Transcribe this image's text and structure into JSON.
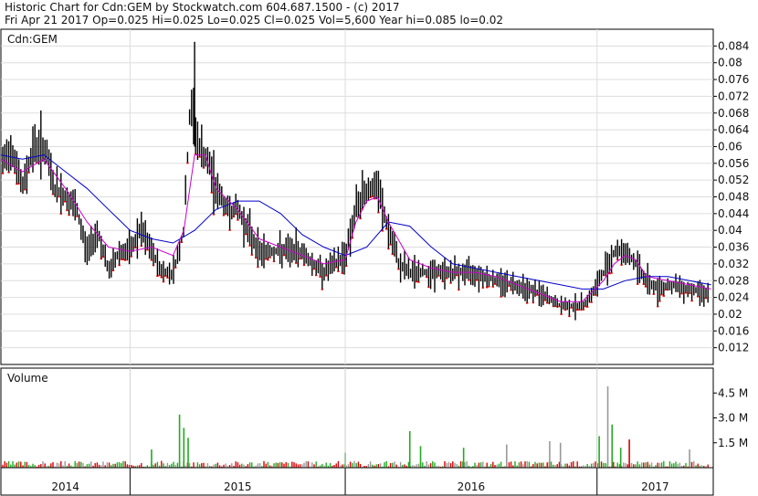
{
  "header": {
    "line1": "Historic Chart for Cdn:GEM by Stockwatch.com 604.687.1500 - (c) 2017",
    "line2": "Fri Apr 21 2017  Op=0.025  Hi=0.025  Lo=0.025  Cl=0.025  Vol=5,600  Year hi=0.085  lo=0.02"
  },
  "colors": {
    "price_bar": "#000000",
    "down_tick": "#dd0000",
    "ma_short": "#cc00cc",
    "ma_long": "#0000cc",
    "vol_up": "#22aa22",
    "vol_down": "#dd0000",
    "vol_flat": "#999999",
    "grid": "#dddddd"
  },
  "chart_data": [
    {
      "type": "bar",
      "subtype": "ohlc",
      "panel": "price",
      "label": "Cdn:GEM",
      "ylim": [
        0.008,
        0.088
      ],
      "y_ticks": [
        "0.084",
        "0.08",
        "0.076",
        "0.072",
        "0.068",
        "0.064",
        "0.06",
        "0.056",
        "0.052",
        "0.048",
        "0.044",
        "0.04",
        "0.036",
        "0.032",
        "0.028",
        "0.024",
        "0.02",
        "0.016",
        "0.012"
      ],
      "y_tick_values": [
        0.084,
        0.08,
        0.076,
        0.072,
        0.068,
        0.064,
        0.06,
        0.056,
        0.052,
        0.048,
        0.044,
        0.04,
        0.036,
        0.032,
        0.028,
        0.024,
        0.02,
        0.016,
        0.012
      ],
      "x_range": [
        2014.0,
        2017.31
      ],
      "grid": true,
      "series": [
        {
          "key": "price",
          "points": [
            [
              2014.0,
              0.055
            ],
            [
              2014.05,
              0.06
            ],
            [
              2014.1,
              0.05
            ],
            [
              2014.15,
              0.06
            ],
            [
              2014.2,
              0.06
            ],
            [
              2014.25,
              0.05
            ],
            [
              2014.3,
              0.048
            ],
            [
              2014.35,
              0.045
            ],
            [
              2014.4,
              0.035
            ],
            [
              2014.45,
              0.04
            ],
            [
              2014.5,
              0.03
            ],
            [
              2014.55,
              0.035
            ],
            [
              2014.6,
              0.035
            ],
            [
              2014.65,
              0.04
            ],
            [
              2014.7,
              0.035
            ],
            [
              2014.75,
              0.03
            ],
            [
              2014.8,
              0.03
            ],
            [
              2014.85,
              0.04
            ],
            [
              2014.88,
              0.07
            ],
            [
              2014.92,
              0.06
            ],
            [
              2014.97,
              0.055
            ],
            [
              2015.0,
              0.05
            ],
            [
              2015.05,
              0.045
            ],
            [
              2015.1,
              0.045
            ],
            [
              2015.15,
              0.04
            ],
            [
              2015.2,
              0.035
            ],
            [
              2015.3,
              0.035
            ],
            [
              2015.4,
              0.035
            ],
            [
              2015.45,
              0.032
            ],
            [
              2015.5,
              0.03
            ],
            [
              2015.55,
              0.032
            ],
            [
              2015.6,
              0.034
            ],
            [
              2015.65,
              0.045
            ],
            [
              2015.7,
              0.05
            ],
            [
              2015.75,
              0.05
            ],
            [
              2015.8,
              0.04
            ],
            [
              2015.85,
              0.032
            ],
            [
              2015.9,
              0.03
            ],
            [
              2016.0,
              0.03
            ],
            [
              2016.1,
              0.03
            ],
            [
              2016.2,
              0.03
            ],
            [
              2016.3,
              0.028
            ],
            [
              2016.4,
              0.027
            ],
            [
              2016.45,
              0.026
            ],
            [
              2016.5,
              0.025
            ],
            [
              2016.6,
              0.022
            ],
            [
              2016.7,
              0.022
            ],
            [
              2016.75,
              0.025
            ],
            [
              2016.8,
              0.03
            ],
            [
              2016.85,
              0.035
            ],
            [
              2016.9,
              0.035
            ],
            [
              2016.95,
              0.032
            ],
            [
              2017.0,
              0.028
            ],
            [
              2017.05,
              0.026
            ],
            [
              2017.1,
              0.027
            ],
            [
              2017.2,
              0.026
            ],
            [
              2017.3,
              0.025
            ]
          ]
        },
        {
          "key": "ma_short",
          "points": [
            [
              2014.0,
              0.057
            ],
            [
              2014.1,
              0.054
            ],
            [
              2014.2,
              0.057
            ],
            [
              2014.3,
              0.05
            ],
            [
              2014.4,
              0.042
            ],
            [
              2014.5,
              0.036
            ],
            [
              2014.6,
              0.035
            ],
            [
              2014.7,
              0.036
            ],
            [
              2014.8,
              0.034
            ],
            [
              2014.85,
              0.04
            ],
            [
              2014.9,
              0.058
            ],
            [
              2014.95,
              0.058
            ],
            [
              2015.0,
              0.05
            ],
            [
              2015.1,
              0.045
            ],
            [
              2015.2,
              0.038
            ],
            [
              2015.3,
              0.036
            ],
            [
              2015.4,
              0.034
            ],
            [
              2015.5,
              0.032
            ],
            [
              2015.6,
              0.033
            ],
            [
              2015.65,
              0.042
            ],
            [
              2015.7,
              0.047
            ],
            [
              2015.75,
              0.048
            ],
            [
              2015.8,
              0.042
            ],
            [
              2015.9,
              0.033
            ],
            [
              2016.0,
              0.031
            ],
            [
              2016.1,
              0.03
            ],
            [
              2016.2,
              0.03
            ],
            [
              2016.3,
              0.029
            ],
            [
              2016.4,
              0.027
            ],
            [
              2016.5,
              0.025
            ],
            [
              2016.6,
              0.023
            ],
            [
              2016.7,
              0.023
            ],
            [
              2016.8,
              0.028
            ],
            [
              2016.85,
              0.032
            ],
            [
              2016.9,
              0.034
            ],
            [
              2016.95,
              0.033
            ],
            [
              2017.0,
              0.029
            ],
            [
              2017.1,
              0.028
            ],
            [
              2017.2,
              0.027
            ],
            [
              2017.3,
              0.026
            ]
          ]
        },
        {
          "key": "ma_long",
          "points": [
            [
              2014.0,
              0.058
            ],
            [
              2014.1,
              0.057
            ],
            [
              2014.2,
              0.058
            ],
            [
              2014.3,
              0.054
            ],
            [
              2014.4,
              0.05
            ],
            [
              2014.5,
              0.045
            ],
            [
              2014.6,
              0.04
            ],
            [
              2014.7,
              0.038
            ],
            [
              2014.8,
              0.037
            ],
            [
              2014.9,
              0.04
            ],
            [
              2015.0,
              0.045
            ],
            [
              2015.1,
              0.047
            ],
            [
              2015.2,
              0.047
            ],
            [
              2015.3,
              0.044
            ],
            [
              2015.4,
              0.039
            ],
            [
              2015.5,
              0.036
            ],
            [
              2015.6,
              0.034
            ],
            [
              2015.7,
              0.036
            ],
            [
              2015.8,
              0.042
            ],
            [
              2015.9,
              0.041
            ],
            [
              2016.0,
              0.036
            ],
            [
              2016.1,
              0.032
            ],
            [
              2016.2,
              0.031
            ],
            [
              2016.3,
              0.03
            ],
            [
              2016.4,
              0.029
            ],
            [
              2016.5,
              0.028
            ],
            [
              2016.6,
              0.027
            ],
            [
              2016.7,
              0.026
            ],
            [
              2016.8,
              0.026
            ],
            [
              2016.9,
              0.028
            ],
            [
              2017.0,
              0.029
            ],
            [
              2017.1,
              0.029
            ],
            [
              2017.2,
              0.028
            ],
            [
              2017.3,
              0.027
            ]
          ]
        }
      ]
    },
    {
      "type": "bar",
      "panel": "volume",
      "label": "Volume",
      "ylim": [
        0,
        6000000
      ],
      "y_ticks": [
        "4.5 M",
        "3.0 M",
        "1.5 M"
      ],
      "y_tick_values": [
        4500000,
        3000000,
        1500000
      ],
      "x_range": [
        2014.0,
        2017.31
      ],
      "grid": false,
      "spikes": [
        {
          "x": 2014.83,
          "v": 3200000,
          "dir": "up"
        },
        {
          "x": 2014.85,
          "v": 2400000,
          "dir": "up"
        },
        {
          "x": 2014.87,
          "v": 1800000,
          "dir": "up"
        },
        {
          "x": 2014.7,
          "v": 1100000,
          "dir": "up"
        },
        {
          "x": 2015.6,
          "v": 900000,
          "dir": "up"
        },
        {
          "x": 2015.9,
          "v": 2200000,
          "dir": "up"
        },
        {
          "x": 2015.95,
          "v": 1300000,
          "dir": "up"
        },
        {
          "x": 2016.15,
          "v": 1200000,
          "dir": "up"
        },
        {
          "x": 2016.35,
          "v": 1400000,
          "dir": "flat"
        },
        {
          "x": 2016.55,
          "v": 1600000,
          "dir": "flat"
        },
        {
          "x": 2016.6,
          "v": 1500000,
          "dir": "flat"
        },
        {
          "x": 2016.78,
          "v": 1900000,
          "dir": "up"
        },
        {
          "x": 2016.82,
          "v": 4900000,
          "dir": "flat"
        },
        {
          "x": 2016.84,
          "v": 2600000,
          "dir": "up"
        },
        {
          "x": 2016.88,
          "v": 1200000,
          "dir": "up"
        },
        {
          "x": 2016.92,
          "v": 1700000,
          "dir": "down"
        },
        {
          "x": 2017.2,
          "v": 1100000,
          "dir": "flat"
        }
      ]
    }
  ],
  "x_axis": {
    "year_labels": [
      {
        "label": "2014",
        "x": 2014.0,
        "end": 2014.6
      },
      {
        "label": "2015",
        "x": 2014.6,
        "end": 2015.6
      },
      {
        "label": "2016",
        "x": 2015.6,
        "end": 2016.77
      },
      {
        "label": "2017",
        "x": 2016.77,
        "end": 2017.31
      }
    ]
  }
}
